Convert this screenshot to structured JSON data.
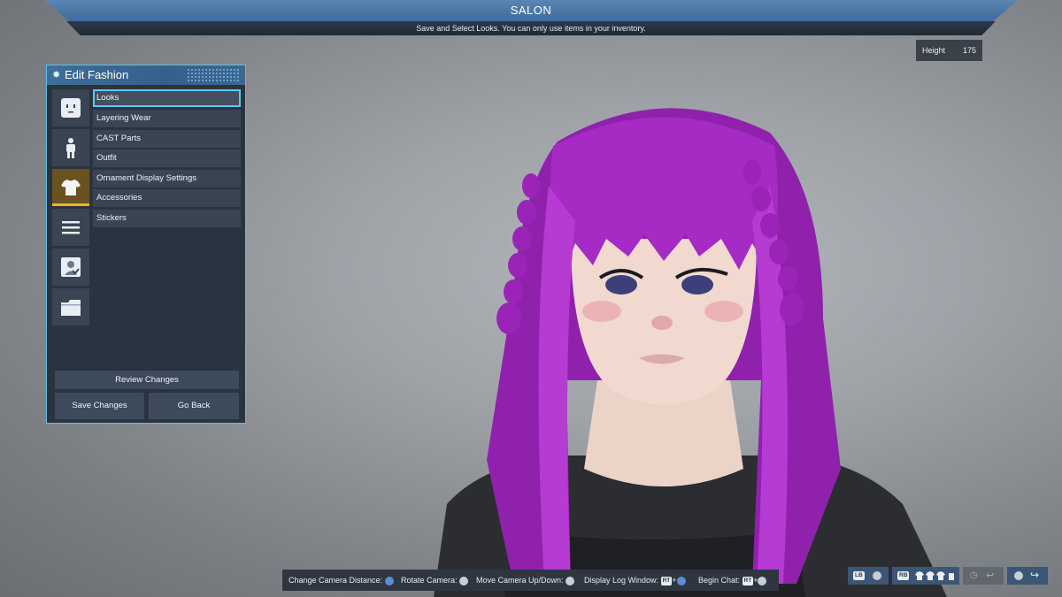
{
  "header": {
    "title": "SALON",
    "subtitle": "Save and Select Looks. You can only use items in your inventory."
  },
  "height": {
    "label": "Height",
    "value": "175"
  },
  "panel": {
    "title": "Edit Fashion",
    "side_tabs": [
      {
        "icon": "face-icon",
        "active": false
      },
      {
        "icon": "body-icon",
        "active": false
      },
      {
        "icon": "shirt-icon",
        "active": true
      },
      {
        "icon": "list-icon",
        "active": false
      },
      {
        "icon": "profile-card-icon",
        "active": false
      },
      {
        "icon": "folder-icon",
        "active": false
      }
    ],
    "menu": [
      {
        "label": "Looks",
        "selected": true
      },
      {
        "label": "Layering Wear"
      },
      {
        "label": "CAST Parts"
      },
      {
        "label": "Outfit"
      },
      {
        "label": "Ornament Display Settings"
      },
      {
        "label": "Accessories"
      },
      {
        "label": "Stickers"
      }
    ],
    "review_label": "Review Changes",
    "save_label": "Save Changes",
    "back_label": "Go Back"
  },
  "help_bar": {
    "camera_distance": "Change Camera Distance:",
    "rotate_camera": "Rotate Camera:",
    "move_camera": "Move Camera Up/Down:",
    "log_window": "Display Log Window:",
    "begin_chat": "Begin Chat:",
    "rt_key": "RT"
  },
  "bottom_right": {
    "lb_key": "LB",
    "rb_key": "RB"
  },
  "colors": {
    "accent": "#59c3e6",
    "banner": "#4a78a8",
    "active_tab": "#f0b52a",
    "hair": "#a52bc4"
  }
}
